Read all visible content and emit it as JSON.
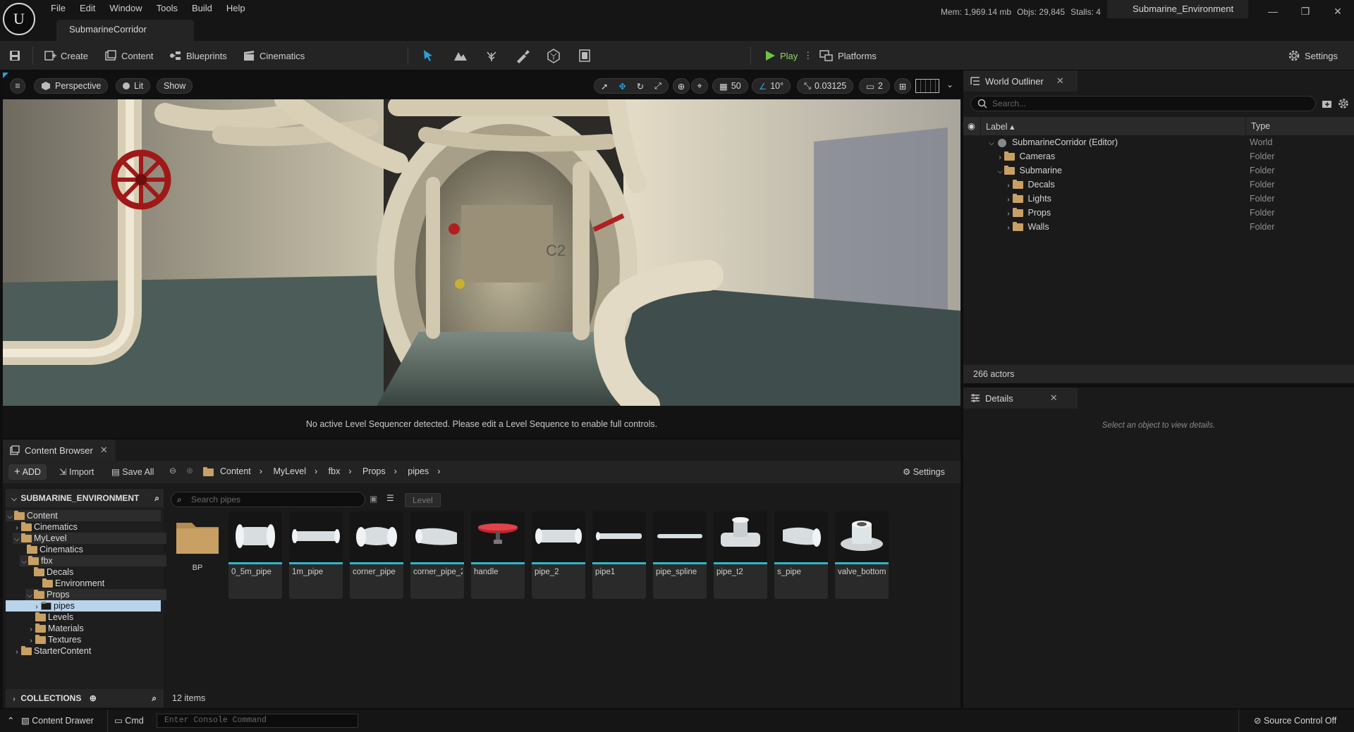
{
  "app": {
    "level_tab": "SubmarineCorridor",
    "project_tab": "Submarine_Environment",
    "menu": [
      "File",
      "Edit",
      "Window",
      "Tools",
      "Build",
      "Help"
    ],
    "stats": {
      "mem": "Mem: 1,969.14 mb",
      "objs": "Objs: 29,845",
      "stalls": "Stalls: 4"
    }
  },
  "toolbar": {
    "create": "Create",
    "content": "Content",
    "blueprints": "Blueprints",
    "cinematics": "Cinematics",
    "play": "Play",
    "platforms": "Platforms",
    "settings": "Settings"
  },
  "viewport": {
    "perspective": "Perspective",
    "lit": "Lit",
    "show": "Show",
    "grid_snap": "50",
    "rot_snap": "10°",
    "scale_snap": "0.03125",
    "cam_speed": "2",
    "sign": "C2",
    "sequencer_msg": "No active Level Sequencer detected. Please edit a Level Sequence to enable full controls."
  },
  "outliner": {
    "title": "World Outliner",
    "search_placeholder": "Search...",
    "col_label": "Label",
    "col_type": "Type",
    "rows": [
      {
        "label": "SubmarineCorridor (Editor)",
        "type": "World"
      },
      {
        "label": "Cameras",
        "type": "Folder"
      },
      {
        "label": "Submarine",
        "type": "Folder"
      },
      {
        "label": "Decals",
        "type": "Folder"
      },
      {
        "label": "Lights",
        "type": "Folder"
      },
      {
        "label": "Props",
        "type": "Folder"
      },
      {
        "label": "Walls",
        "type": "Folder"
      }
    ],
    "actors": "266 actors"
  },
  "details": {
    "title": "Details",
    "empty": "Select an object to view details."
  },
  "content_browser": {
    "title": "Content Browser",
    "add": "ADD",
    "import": "Import",
    "save_all": "Save All",
    "path": [
      "Content",
      "MyLevel",
      "fbx",
      "Props",
      "pipes"
    ],
    "settings": "Settings",
    "root": "SUBMARINE_ENVIRONMENT",
    "search_placeholder": "Search pipes",
    "filter_chip": "Level",
    "tree": [
      "Content",
      "Cinematics",
      "MyLevel",
      "Cinematics",
      "fbx",
      "Decals",
      "Environment",
      "Props",
      "pipes",
      "Levels",
      "Materials",
      "Textures",
      "StarterContent"
    ],
    "folder_item": "BP",
    "assets": [
      "0_5m_pipe",
      "1m_pipe",
      "corner_pipe",
      "corner_pipe_2",
      "handle",
      "pipe_2",
      "pipe1",
      "pipe_spline",
      "pipe_t2",
      "s_pipe",
      "valve_bottom"
    ],
    "count": "12 items",
    "collections": "COLLECTIONS"
  },
  "statusbar": {
    "drawer": "Content Drawer",
    "cmd": "Cmd",
    "console_placeholder": "Enter Console Command",
    "source_control": "Source Control Off"
  }
}
